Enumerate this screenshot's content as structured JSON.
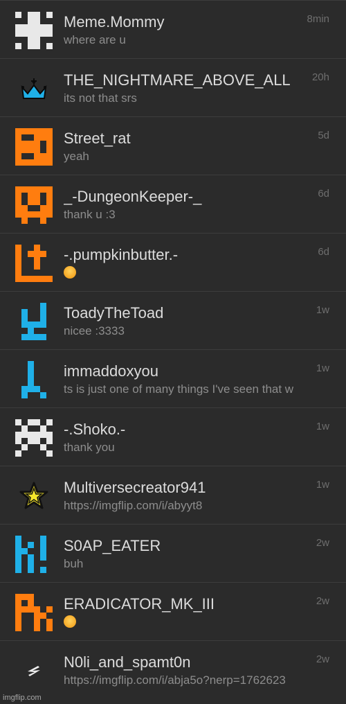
{
  "conversations": [
    {
      "name": "Meme.Mommy",
      "message": "where are u",
      "time": "8min",
      "avatar_icon": "white-pixel-cross-icon",
      "avatar_color": "#e8e8e8"
    },
    {
      "name": "THE_NIGHTMARE_ABOVE_ALL",
      "message": "its not that srs",
      "time": "20h",
      "avatar_icon": "blue-crown-icon",
      "avatar_color": "#1fb0e8"
    },
    {
      "name": "Street_rat",
      "message": "yeah",
      "time": "5d",
      "avatar_icon": "orange-pixel-block-icon",
      "avatar_color": "#ff7d0f"
    },
    {
      "name": "_-DungeonKeeper-_",
      "message": "thank u :3",
      "time": "6d",
      "avatar_icon": "orange-pixel-skull-icon",
      "avatar_color": "#ff7d0f"
    },
    {
      "name": "-.pumpkinbutter.-",
      "message": "",
      "message_icon": "flushed-face-emoji",
      "time": "6d",
      "avatar_icon": "orange-pixel-corner-icon",
      "avatar_color": "#ff7d0f"
    },
    {
      "name": "ToadyTheToad",
      "message": "nicee :3333",
      "time": "1w",
      "avatar_icon": "blue-pixel-chair-icon",
      "avatar_color": "#1fb0e8"
    },
    {
      "name": "immaddoxyou",
      "message": "ts is just one of many things I've seen that w",
      "time": "1w",
      "avatar_icon": "blue-pixel-stand-icon",
      "avatar_color": "#1fb0e8"
    },
    {
      "name": "-.Shoko.-",
      "message": "thank you",
      "time": "1w",
      "avatar_icon": "white-pixel-checker-icon",
      "avatar_color": "#e8e8e8"
    },
    {
      "name": "Multiversecreator941",
      "message": "https://imgflip.com/i/abyyt8",
      "time": "1w",
      "avatar_icon": "yellow-star-icon",
      "avatar_color": "#f5e62a"
    },
    {
      "name": "S0AP_EATER",
      "message": "buh",
      "time": "2w",
      "avatar_icon": "blue-pixel-k-exclaim-icon",
      "avatar_color": "#1fb0e8"
    },
    {
      "name": "ERADICATOR_MK_III",
      "message": "",
      "message_icon": "peeking-face-emoji",
      "time": "2w",
      "avatar_icon": "orange-pixel-pk-icon",
      "avatar_color": "#ff7d0f"
    },
    {
      "name": "N0li_and_spamt0n",
      "message": "https://imgflip.com/i/abja5o?nerp=1762623",
      "time": "2w",
      "avatar_icon": "white-lightning-icon",
      "avatar_color": "#f0f0f0"
    }
  ],
  "watermark": "imgflip.com"
}
